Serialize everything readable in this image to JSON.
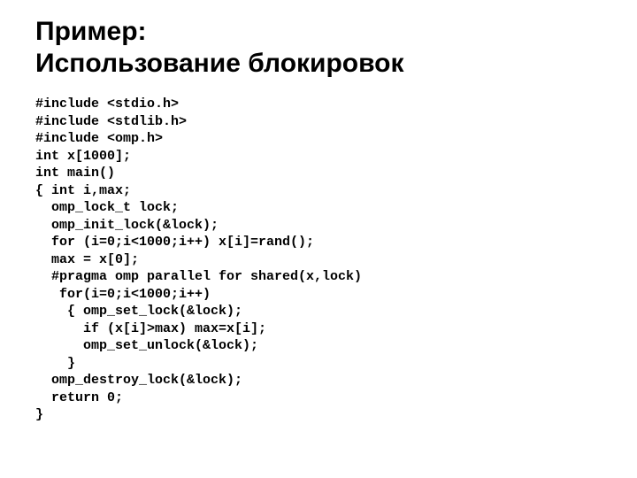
{
  "title_line1": "Пример:",
  "title_line2": "Использование блокировок",
  "code": "#include <stdio.h>\n#include <stdlib.h>\n#include <omp.h>\nint x[1000];\nint main()\n{ int i,max;\n  omp_lock_t lock;\n  omp_init_lock(&lock);\n  for (i=0;i<1000;i++) x[i]=rand();\n  max = x[0];\n  #pragma omp parallel for shared(x,lock)\n   for(i=0;i<1000;i++)\n    { omp_set_lock(&lock);\n      if (x[i]>max) max=x[i];\n      omp_set_unlock(&lock);\n    }\n  omp_destroy_lock(&lock);\n  return 0;\n}"
}
